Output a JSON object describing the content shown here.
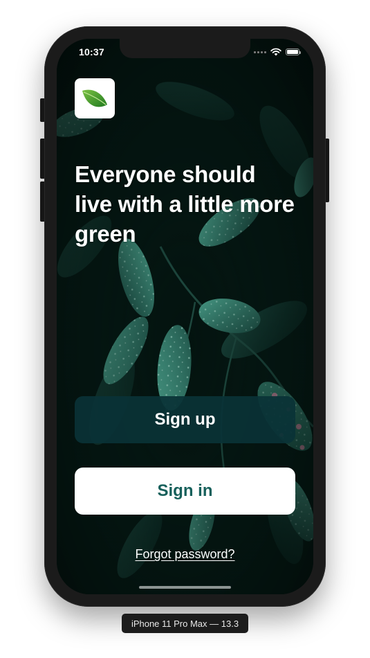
{
  "status_bar": {
    "time": "10:37",
    "icons": [
      "signal-icon",
      "wifi-icon",
      "battery-icon"
    ]
  },
  "app": {
    "logo_icon": "leaf-icon",
    "headline": "Everyone should live with a little more green",
    "signup_label": "Sign up",
    "signin_label": "Sign in",
    "forgot_label": "Forgot password?"
  },
  "simulator": {
    "device_label": "iPhone 11 Pro Max — 13.3"
  },
  "colors": {
    "signup_bg": "#0a3337",
    "signin_text": "#17605b",
    "leaf_green": "#3a8f2a",
    "foliage": "#3a8f7e"
  }
}
